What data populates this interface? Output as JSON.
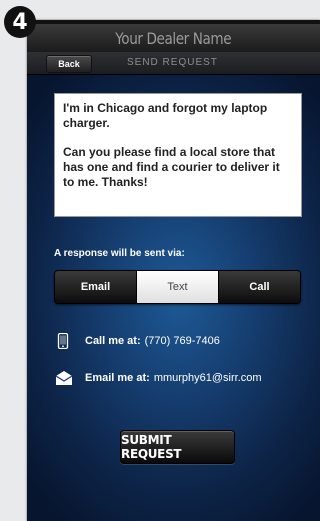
{
  "step_number": "4",
  "header": {
    "dealer_name": "Your Dealer Name"
  },
  "nav": {
    "back_label": "Back",
    "title": "SEND REQUEST"
  },
  "message": {
    "paragraph1": "I'm in Chicago and forgot my laptop charger.",
    "paragraph2": "Can you please find a local store that has one and find a courier to deliver it to me. Thanks!"
  },
  "response": {
    "label": "A response will be sent via:",
    "options": [
      "Email",
      "Text",
      "Call"
    ],
    "selected": "Text"
  },
  "contact": {
    "call_label": "Call me at:",
    "call_value": "(770) 769-7406",
    "email_label": "Email me at:",
    "email_value": "mmurphy61@sirr.com"
  },
  "submit_label": "SUBMIT REQUEST",
  "colors": {
    "background_blue": "#163f72",
    "title_bar": "#1b1b1b",
    "segment_active": "#ffffff"
  },
  "icons": {
    "phone": "mobile-phone-icon",
    "email": "envelope-icon"
  }
}
